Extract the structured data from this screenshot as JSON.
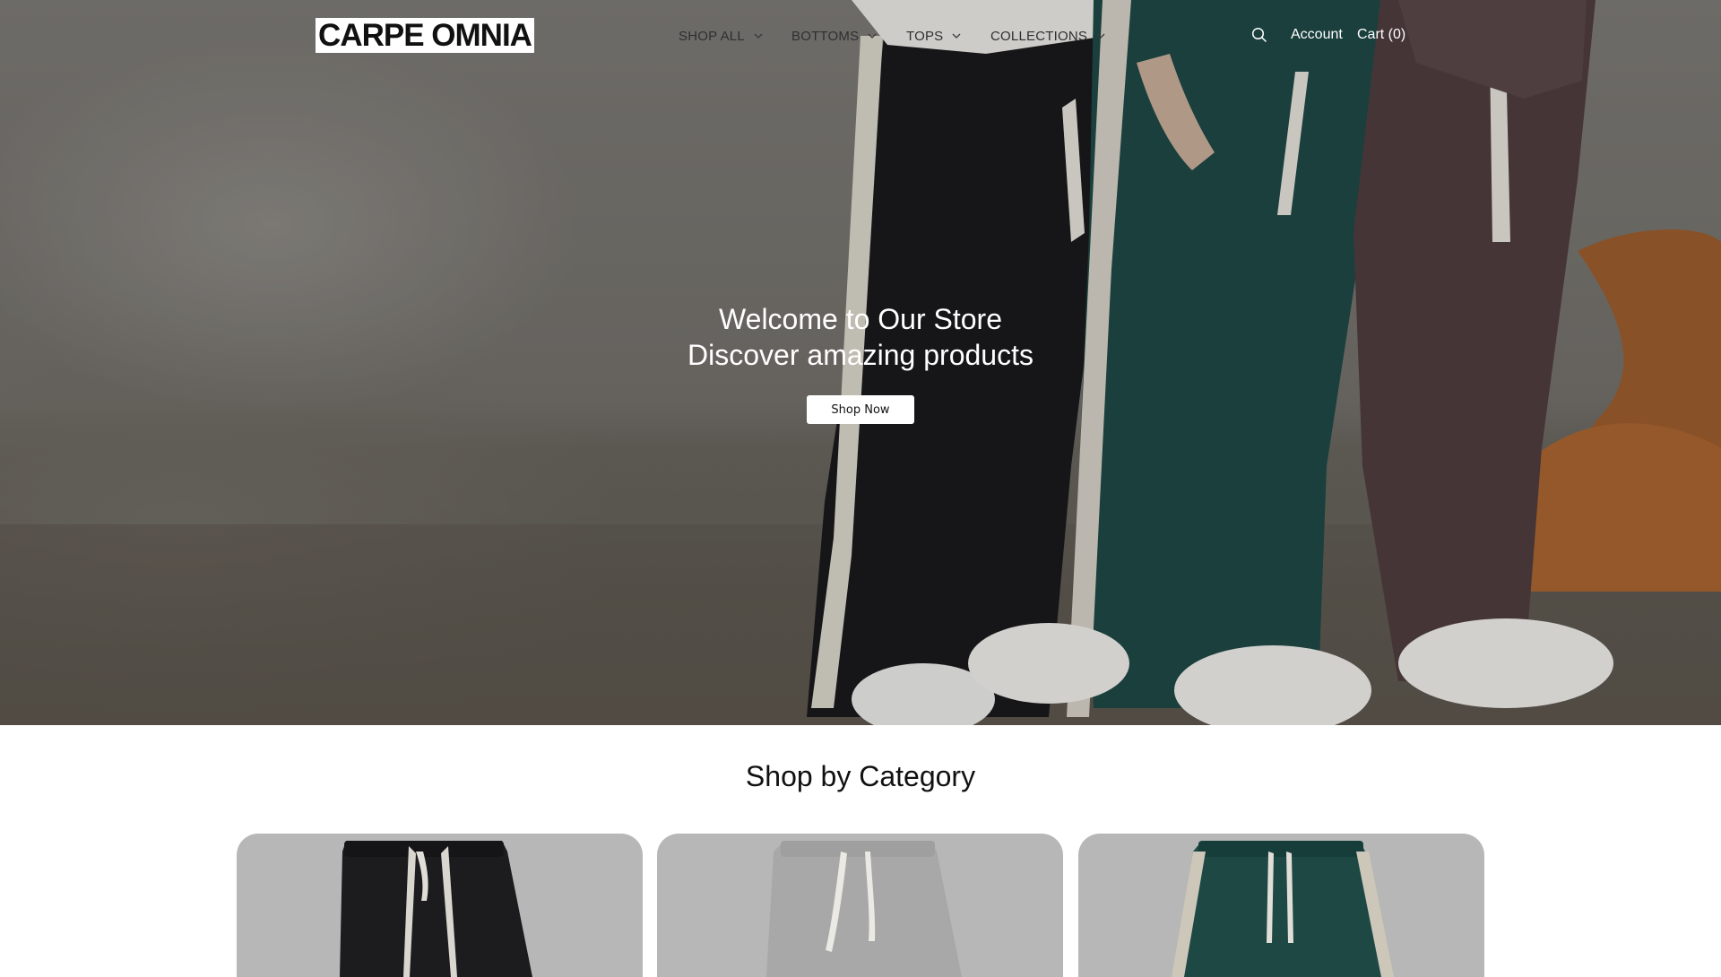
{
  "header": {
    "logo": "CARPE OMNIA",
    "nav": [
      {
        "label": "SHOP ALL"
      },
      {
        "label": "BOTTOMS"
      },
      {
        "label": "TOPS"
      },
      {
        "label": "COLLECTIONS"
      }
    ],
    "account": "Account",
    "cart": "Cart (0)"
  },
  "hero": {
    "title": "Welcome to Our Store",
    "subtitle": "Discover amazing products",
    "button": "Shop Now"
  },
  "categories": {
    "title": "Shop by Category"
  },
  "colors": {
    "card_bg": "#b7b7b7",
    "black_pants": "#1a1a1c",
    "grey_pants": "#a9a9a9",
    "green_pants": "#1e4a46",
    "brown_pants": "#4f3d3e"
  },
  "icons": {
    "search": "search-icon",
    "chevron": "chevron-down-icon"
  }
}
